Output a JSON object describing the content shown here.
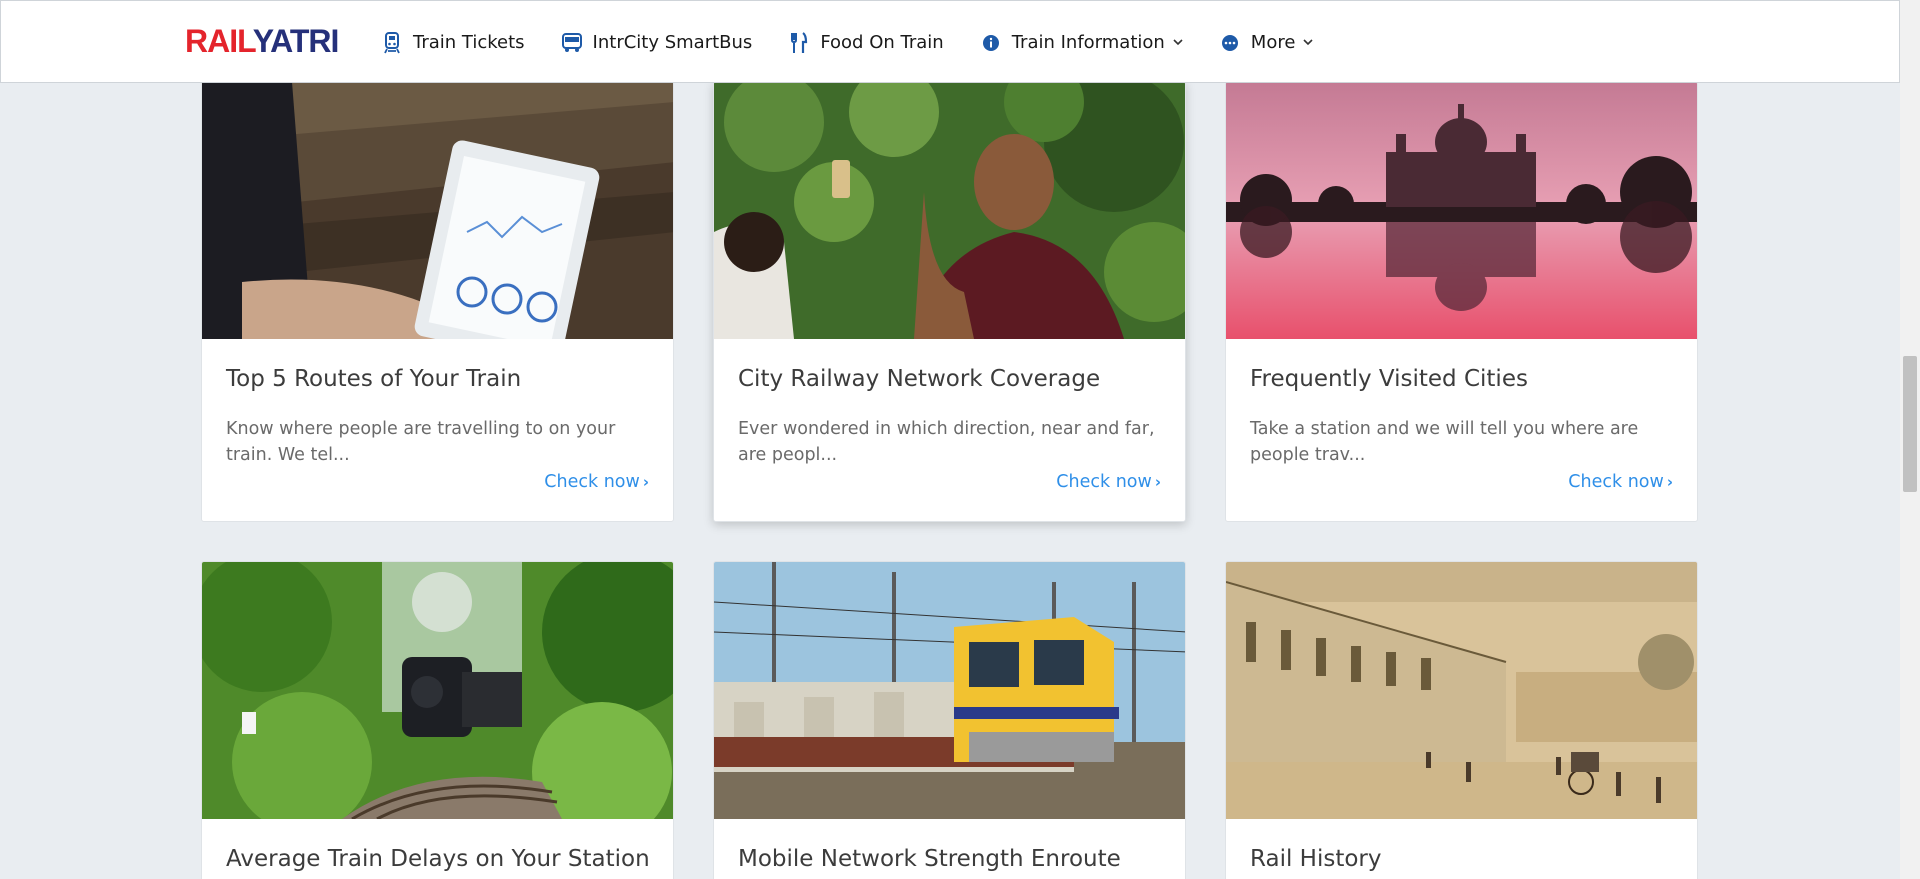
{
  "brand": {
    "part1": "RAIL",
    "part2": "YATRI"
  },
  "nav": [
    {
      "label": "Train Tickets",
      "icon": "train-icon",
      "has_dropdown": false
    },
    {
      "label": "IntrCity SmartBus",
      "icon": "bus-icon",
      "has_dropdown": false
    },
    {
      "label": "Food On Train",
      "icon": "fork-knife-icon",
      "has_dropdown": false
    },
    {
      "label": "Train Information",
      "icon": "info-icon",
      "has_dropdown": true
    },
    {
      "label": "More",
      "icon": "more-dots-icon",
      "has_dropdown": true
    }
  ],
  "cards": [
    {
      "title": "Top 5 Routes of Your Train",
      "desc": "Know where people are travelling to on your train. We tel...",
      "cta": "Check now",
      "image": "tablet-with-charts-photo"
    },
    {
      "title": "City Railway Network Coverage",
      "desc": "Ever wondered in which direction, near and far, are peopl...",
      "cta": "Check now",
      "image": "monk-with-phone-photo"
    },
    {
      "title": "Frequently Visited Cities",
      "desc": "Take a station and we will tell you where are people trav...",
      "cta": "Check now",
      "image": "victoria-memorial-photo"
    },
    {
      "title": "Average Train Delays on Your Station",
      "image": "steam-train-forest-photo"
    },
    {
      "title": "Mobile Network Strength Enroute",
      "image": "mumbai-local-train-photo"
    },
    {
      "title": "Rail History",
      "image": "historic-railway-street-sketch"
    }
  ],
  "colors": {
    "brand_red": "#e4242c",
    "brand_blue": "#25307a",
    "link_blue": "#2f8fe8",
    "page_bg": "#e9edf1"
  }
}
